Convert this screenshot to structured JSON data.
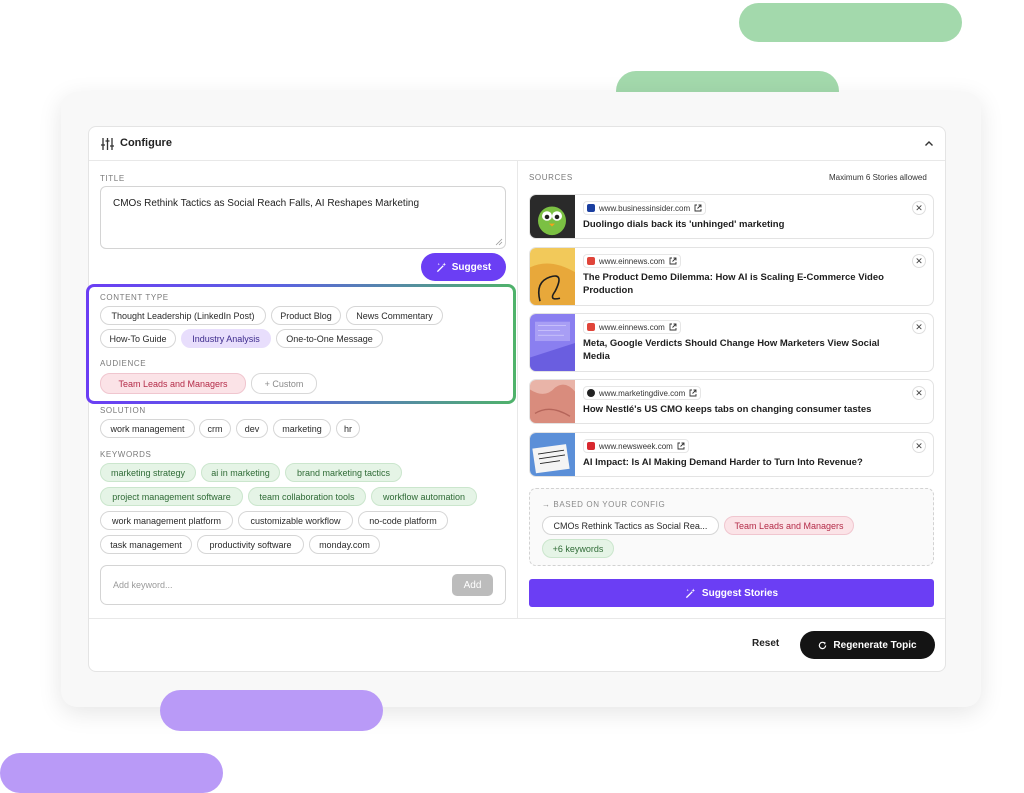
{
  "header": {
    "title": "Configure"
  },
  "left": {
    "title_label": "TITLE",
    "title_value": "CMOs Rethink Tactics as Social Reach Falls, AI Reshapes Marketing",
    "suggest_label": "Suggest",
    "content_type_label": "CONTENT TYPE",
    "content_types": [
      {
        "label": "Thought Leadership (LinkedIn Post)",
        "selected": false
      },
      {
        "label": "Product Blog",
        "selected": false
      },
      {
        "label": "News Commentary",
        "selected": false
      },
      {
        "label": "How-To Guide",
        "selected": false
      },
      {
        "label": "Industry Analysis",
        "selected": true
      },
      {
        "label": "One-to-One Message",
        "selected": false
      }
    ],
    "audience_label": "AUDIENCE",
    "audience": [
      {
        "label": "Team Leads and Managers",
        "selected": true
      },
      {
        "label": "+ Custom",
        "selected": false
      }
    ],
    "solution_label": "SOLUTION",
    "solutions": [
      "work management",
      "crm",
      "dev",
      "marketing",
      "hr"
    ],
    "keywords_label": "KEYWORDS",
    "keywords": [
      {
        "label": "marketing strategy",
        "suggested": true
      },
      {
        "label": "ai in marketing",
        "suggested": true
      },
      {
        "label": "brand marketing tactics",
        "suggested": true
      },
      {
        "label": "project management software",
        "suggested": true
      },
      {
        "label": "team collaboration tools",
        "suggested": true
      },
      {
        "label": "workflow automation",
        "suggested": true
      },
      {
        "label": "work management platform",
        "suggested": false
      },
      {
        "label": "customizable workflow",
        "suggested": false
      },
      {
        "label": "no-code platform",
        "suggested": false
      },
      {
        "label": "task management",
        "suggested": false
      },
      {
        "label": "productivity software",
        "suggested": false
      },
      {
        "label": "monday.com",
        "suggested": false
      }
    ],
    "keyword_input_placeholder": "Add keyword...",
    "add_label": "Add"
  },
  "right": {
    "sources_label": "SOURCES",
    "max_note": "Maximum 6 Stories allowed",
    "sources": [
      {
        "domain": "www.businessinsider.com",
        "title": "Duolingo dials back its 'unhinged' marketing",
        "favicon_color": "#1b3fa0"
      },
      {
        "domain": "www.einnews.com",
        "title": "The Product Demo Dilemma: How AI is Scaling E-Commerce Video Production",
        "favicon_color": "#e0453a"
      },
      {
        "domain": "www.einnews.com",
        "title": "Meta, Google Verdicts Should Change How Marketers View Social Media",
        "favicon_color": "#e0453a"
      },
      {
        "domain": "www.marketingdive.com",
        "title": "How Nestlé's US CMO keeps tabs on changing consumer tastes",
        "favicon_color": "#222222"
      },
      {
        "domain": "www.newsweek.com",
        "title": "AI Impact: Is AI Making Demand Harder to Turn Into Revenue?",
        "favicon_color": "#d8282f"
      }
    ],
    "based_label": "→ BASED ON YOUR CONFIG",
    "based_chips": {
      "title": "CMOs Rethink Tactics as Social Rea...",
      "audience": "Team Leads and Managers",
      "keywords": "+6 keywords"
    },
    "suggest_stories_label": "Suggest Stories"
  },
  "footer": {
    "reset_label": "Reset",
    "regenerate_label": "Regenerate Topic"
  },
  "colors": {
    "accent": "#6b3ef4",
    "deco_green": "#a3d9ac",
    "deco_purple": "#b99af7"
  }
}
